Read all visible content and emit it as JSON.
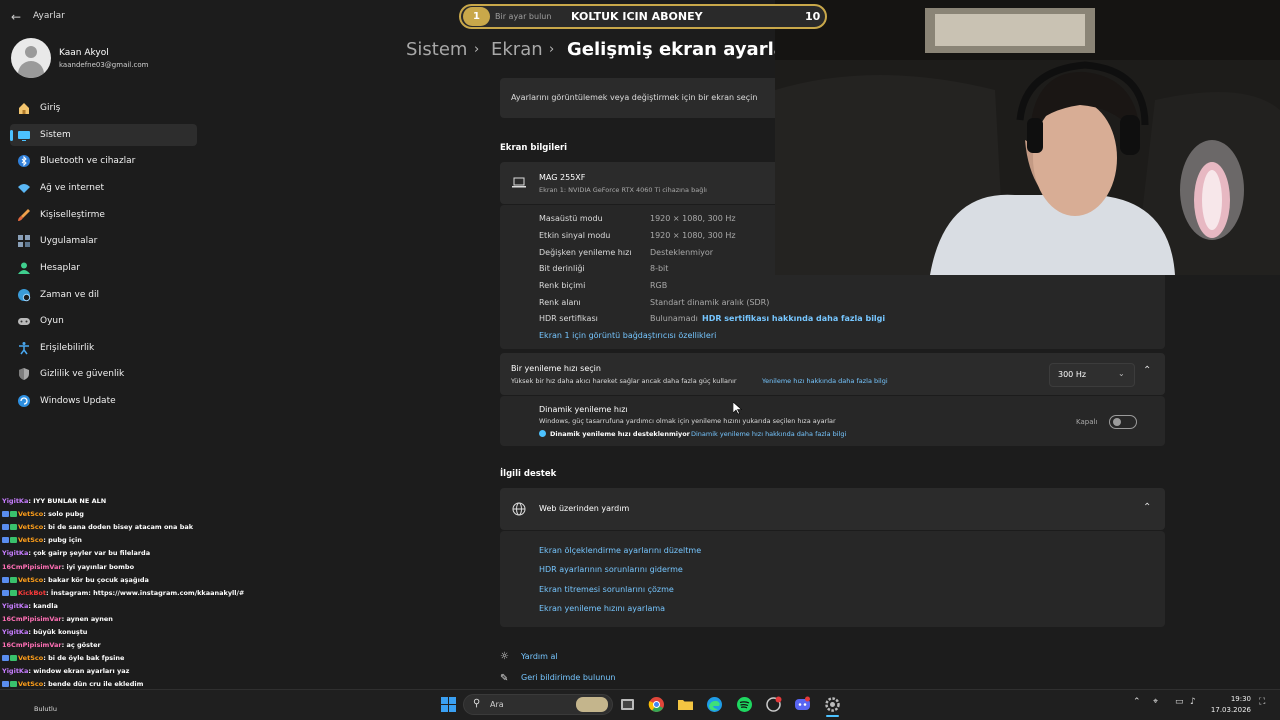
{
  "app": {
    "title": "Ayarlar"
  },
  "user": {
    "name": "Kaan Akyol",
    "email": "kaandefne03@gmail.com"
  },
  "sidebar": {
    "items": [
      {
        "label": "Giriş",
        "icon": "home-icon"
      },
      {
        "label": "Sistem",
        "icon": "display-icon",
        "active": true
      },
      {
        "label": "Bluetooth ve cihazlar",
        "icon": "bluetooth-icon"
      },
      {
        "label": "Ağ ve internet",
        "icon": "wifi-icon"
      },
      {
        "label": "Kişiselleştirme",
        "icon": "brush-icon"
      },
      {
        "label": "Uygulamalar",
        "icon": "apps-icon"
      },
      {
        "label": "Hesaplar",
        "icon": "person-icon"
      },
      {
        "label": "Zaman ve dil",
        "icon": "globe-clock-icon"
      },
      {
        "label": "Oyun",
        "icon": "gamepad-icon"
      },
      {
        "label": "Erişilebilirlik",
        "icon": "accessibility-icon"
      },
      {
        "label": "Gizlilik ve güvenlik",
        "icon": "shield-icon"
      },
      {
        "label": "Windows Update",
        "icon": "update-icon"
      }
    ]
  },
  "breadcrumb": {
    "items": [
      "Sistem",
      "Ekran",
      "Gelişmiş ekran ayarları"
    ]
  },
  "stream_bar": {
    "left_number": "1",
    "search_placeholder": "Bir ayar bulun",
    "title": "KOLTUK ICIN ABONEY",
    "right_number": "10"
  },
  "select_display": {
    "label": "Ayarlarını görüntülemek veya değiştirmek için bir ekran seçin"
  },
  "display_info": {
    "heading": "Ekran bilgileri",
    "monitor_name": "MAG 255XF",
    "monitor_sub": "Ekran 1: NVIDIA GeForce RTX 4060 Ti cihazına bağlı",
    "rows": [
      {
        "label": "Masaüstü modu",
        "value": "1920 × 1080, 300 Hz"
      },
      {
        "label": "Etkin sinyal modu",
        "value": "1920 × 1080, 300 Hz"
      },
      {
        "label": "Değişken yenileme hızı",
        "value": "Desteklenmiyor"
      },
      {
        "label": "Bit derinliği",
        "value": "8-bit"
      },
      {
        "label": "Renk biçimi",
        "value": "RGB"
      },
      {
        "label": "Renk alanı",
        "value": "Standart dinamik aralık (SDR)"
      }
    ],
    "hdr_label": "HDR sertifikası",
    "hdr_value": "Bulunamadı",
    "hdr_link": "HDR sertifikası hakkında daha fazla bilgi",
    "adapter_link": "Ekran 1 için görüntü bağdaştırıcısı özellikleri"
  },
  "refresh": {
    "title": "Bir yenileme hızı seçin",
    "desc": "Yüksek bir hız daha akıcı hareket sağlar ancak daha fazla güç kullanır",
    "link": "Yenileme hızı hakkında daha fazla bilgi",
    "selected": "300 Hz",
    "dynamic_title": "Dinamik yenileme hızı",
    "dynamic_desc": "Windows, güç tasarrufuna yardımcı olmak için yenileme hızını yukarıda seçilen hıza ayarlar",
    "dynamic_note": "Dinamik yenileme hızı desteklenmiyor",
    "dynamic_link": "Dinamik yenileme hızı hakkında daha fazla bilgi",
    "toggle_state": "Kapalı"
  },
  "support": {
    "heading": "İlgili destek",
    "web_help": "Web üzerinden yardım",
    "links": [
      "Ekran ölçeklendirme ayarlarını düzeltme",
      "HDR ayarlarının sorunlarını giderme",
      "Ekran titremesi sorunlarını çözme",
      "Ekran yenileme hızını ayarlama"
    ]
  },
  "footer": {
    "help": "Yardım al",
    "feedback": "Geri bildirimde bulunun"
  },
  "chat": [
    {
      "user": "YigitKa",
      "text": ": IYY BUNLAR NE ALN",
      "color": "#c77dff",
      "badge": false
    },
    {
      "user": "VetSco",
      "text": ": solo pubg",
      "color": "#ff9f1a",
      "badge": true
    },
    {
      "user": "VetSco",
      "text": ": bi de sana doden bisey atacam ona bak",
      "color": "#ff9f1a",
      "badge": true
    },
    {
      "user": "VetSco",
      "text": ": pubg için",
      "color": "#ff9f1a",
      "badge": true
    },
    {
      "user": "YigitKa",
      "text": ": çok gairp şeyler var bu filelarda",
      "color": "#c77dff",
      "badge": false
    },
    {
      "user": "16CmPipisimVar",
      "text": ": iyi yayınlar bombo",
      "color": "#ff6fb5",
      "badge": false
    },
    {
      "user": "VetSco",
      "text": ": bakar kör bu çocuk aşağıda",
      "color": "#ff9f1a",
      "badge": true
    },
    {
      "user": "KickBot",
      "text": ": İnstagram: https://www.instagram.com/kkaanakyll/#",
      "color": "#ff3b3b",
      "badge": true
    },
    {
      "user": "YigitKa",
      "text": ": kandla",
      "color": "#c77dff",
      "badge": false
    },
    {
      "user": "16CmPipisimVar",
      "text": ": aynen aynen",
      "color": "#ff6fb5",
      "badge": false
    },
    {
      "user": "YigitKa",
      "text": ": büyük konuştu",
      "color": "#c77dff",
      "badge": false
    },
    {
      "user": "16CmPipisimVar",
      "text": ": aç göster",
      "color": "#ff6fb5",
      "badge": false
    },
    {
      "user": "VetSco",
      "text": ": bi de öyle bak fpsine",
      "color": "#ff9f1a",
      "badge": true
    },
    {
      "user": "YigitKa",
      "text": ": window ekran ayarları yaz",
      "color": "#c77dff",
      "badge": false
    },
    {
      "user": "VetSco",
      "text": ": bende dün cru ile ekledim",
      "color": "#ff9f1a",
      "badge": true
    },
    {
      "user": "YigitKa",
      "text": ": ekran ayarlarından çözünürlük değişiyo",
      "color": "#c77dff",
      "badge": false
    },
    {
      "user": "YigitKa",
      "text": ": gelişmiş ekran",
      "color": "#c77dff",
      "badge": false
    }
  ],
  "taskbar": {
    "search_placeholder": "Ara",
    "time": "19:30",
    "date": "17.03.2026",
    "weather_label": "Bulutlu"
  },
  "colors": {
    "accent": "#4cc2ff",
    "link": "#76c6ff",
    "background": "#1c1c1c",
    "card": "#2b2b2b"
  }
}
